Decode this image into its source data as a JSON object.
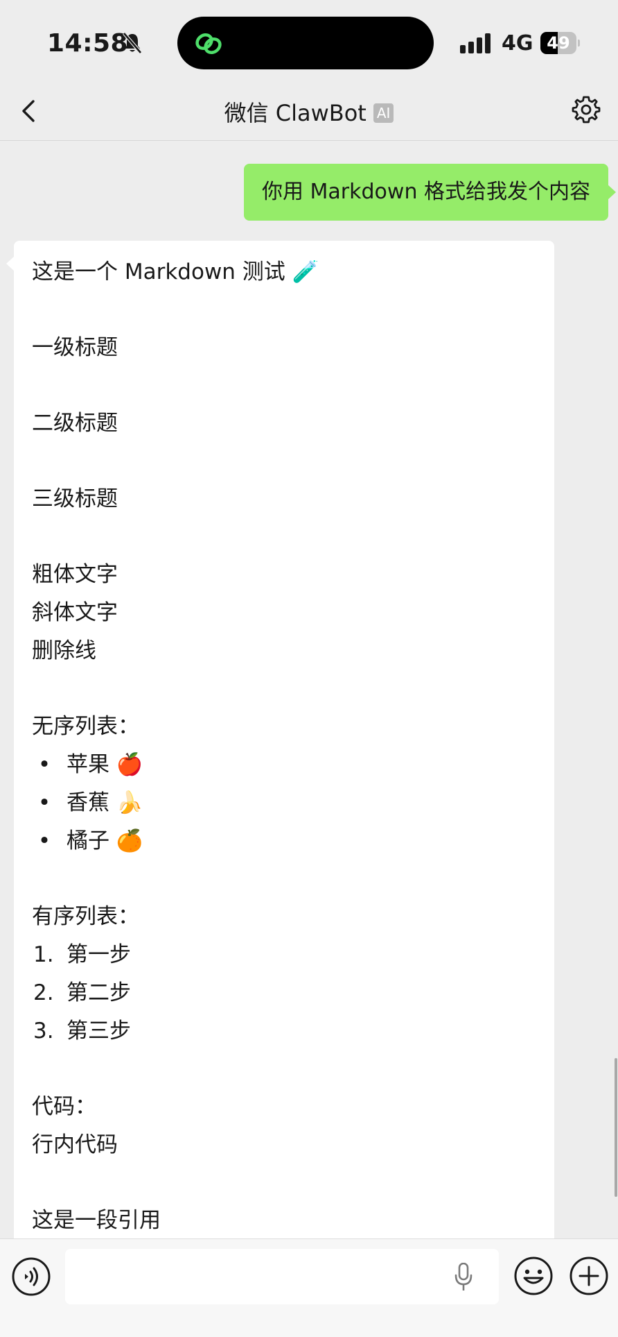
{
  "status_bar": {
    "time": "14:58",
    "network": "4G",
    "battery": "49",
    "battery_level": 0.49
  },
  "nav": {
    "title": "微信 ClawBot",
    "badge": "AI"
  },
  "user_message": "你用 Markdown 格式给我发个内容",
  "bot_message": {
    "intro": "这是一个 Markdown 测试 🧪",
    "heading1": "一级标题",
    "heading2": "二级标题",
    "heading3": "三级标题",
    "bold": "粗体文字",
    "italic": "斜体文字",
    "strike": "删除线",
    "unordered_label": "无序列表：",
    "unordered": [
      {
        "bullet": "•",
        "text": "苹果 🍎"
      },
      {
        "bullet": "•",
        "text": "香蕉 🍌"
      },
      {
        "bullet": "•",
        "text": "橘子 🍊"
      }
    ],
    "ordered_label": "有序列表：",
    "ordered": [
      {
        "num": "1.",
        "text": "第一步"
      },
      {
        "num": "2.",
        "text": "第二步"
      },
      {
        "num": "3.",
        "text": "第三步"
      }
    ],
    "code_label": "代码：",
    "inline_code": "行内代码",
    "quote": "这是一段引用"
  },
  "input": {
    "placeholder": ""
  },
  "icons": [
    "back-icon",
    "gear-icon",
    "voice-icon",
    "mic-icon",
    "emoji-icon",
    "add-icon",
    "bell-slash-icon",
    "signal-icon",
    "battery-icon"
  ]
}
